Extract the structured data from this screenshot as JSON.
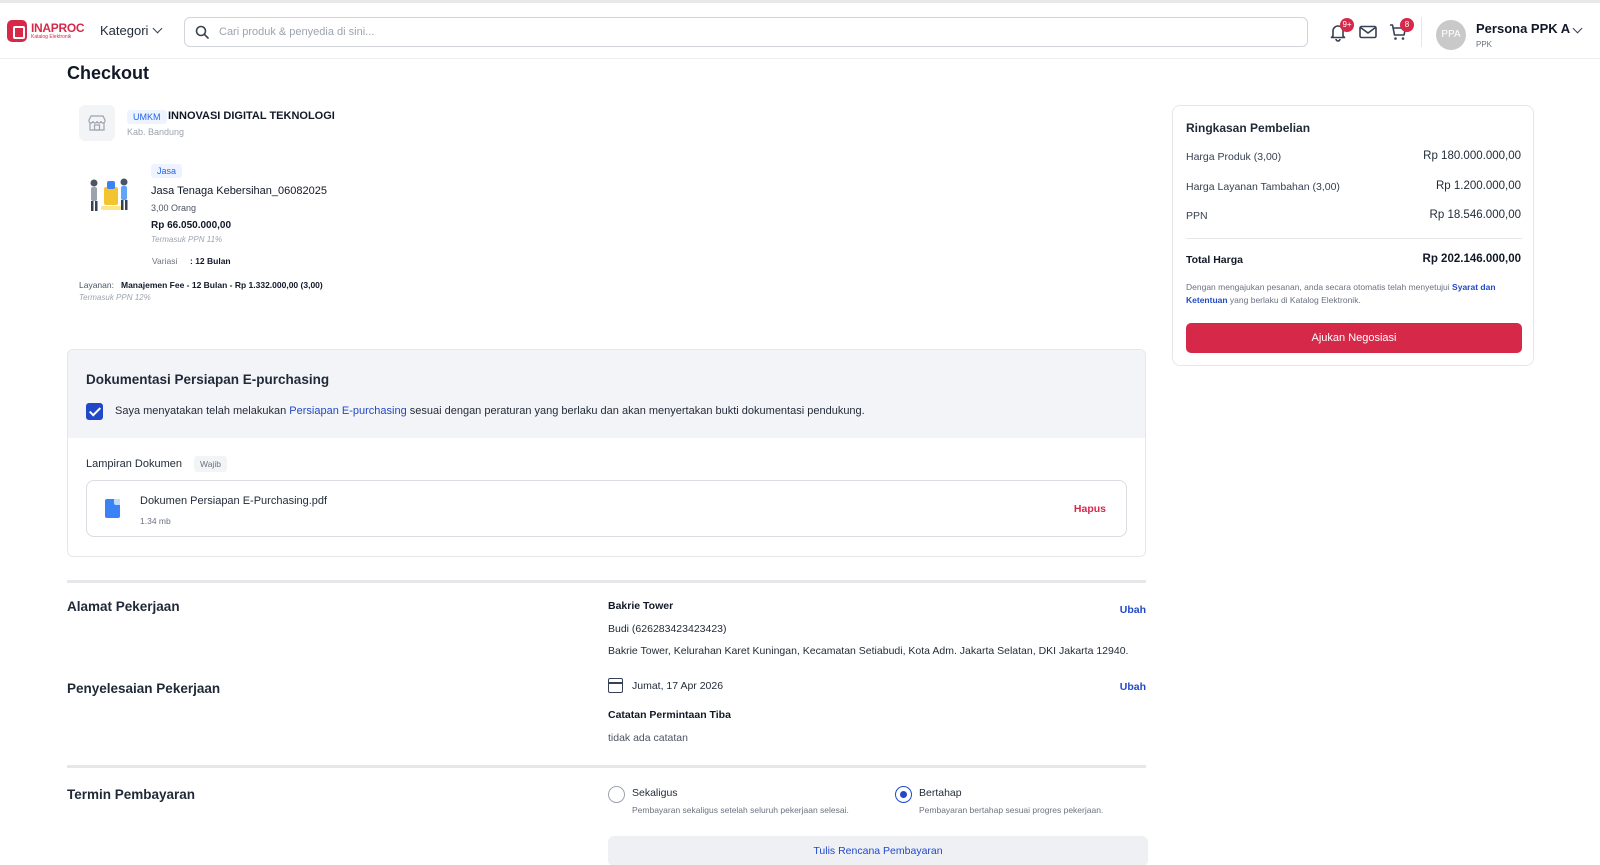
{
  "header": {
    "logo_title": "INAPROC",
    "logo_subtitle": "Katalog Elektronik",
    "kategori_label": "Kategori",
    "search_placeholder": "Cari produk & penyedia di sini...",
    "notif_badge": "9+",
    "cart_badge": "8",
    "avatar_initials": "PPA",
    "user_name": "Persona PPK A",
    "user_role": "PPK"
  },
  "page_title": "Checkout",
  "shop": {
    "tag": "UMKM",
    "name": "INNOVASI DIGITAL TEKNOLOGI",
    "location": "Kab. Bandung"
  },
  "product": {
    "tag": "Jasa",
    "name": "Jasa Tenaga Kebersihan_06082025",
    "qty": "3,00 Orang",
    "price": "Rp 66.050.000,00",
    "ppn_note": "Termasuk PPN 11%",
    "variant_label": "Variasi",
    "variant_value": ": 12 Bulan",
    "service_label": "Layanan:",
    "service_value": "Manajemen Fee - 12 Bulan - Rp 1.332.000,00 (3,00)",
    "service_ppn_note": "Termasuk PPN 12%"
  },
  "documentation": {
    "title": "Dokumentasi Persiapan E-purchasing",
    "statement_prefix": "Saya menyatakan telah melakukan ",
    "statement_link": "Persiapan E-purchasing",
    "statement_suffix": " sesuai dengan peraturan yang berlaku dan akan menyertakan bukti dokumentasi pendukung.",
    "attachment_label": "Lampiran Dokumen",
    "required_tag": "Wajib",
    "file_name": "Dokumen Persiapan E-Purchasing.pdf",
    "file_size": "1.34 mb",
    "delete_label": "Hapus"
  },
  "address": {
    "title": "Alamat Pekerjaan",
    "name": "Bakrie Tower",
    "contact": "Budi (626283423423423)",
    "full": "Bakrie Tower, Kelurahan Karet Kuningan, Kecamatan Setiabudi, Kota Adm. Jakarta Selatan, DKI Jakarta 12940.",
    "edit_label": "Ubah"
  },
  "completion": {
    "title": "Penyelesaian Pekerjaan",
    "date": "Jumat, 17 Apr 2026",
    "note_title": "Catatan Permintaan Tiba",
    "note_text": "tidak ada catatan",
    "edit_label": "Ubah"
  },
  "payment": {
    "title": "Termin Pembayaran",
    "options": [
      {
        "label": "Sekaligus",
        "desc": "Pembayaran sekaligus setelah seluruh pekerjaan selesai."
      },
      {
        "label": "Bertahap",
        "desc": "Pembayaran bertahap sesuai progres pekerjaan."
      }
    ],
    "selected": "Bertahap",
    "plan_button": "Tulis Rencana Pembayaran"
  },
  "summary": {
    "title": "Ringkasan Pembelian",
    "rows": [
      {
        "label": "Harga Produk (3,00)",
        "value": "Rp 180.000.000,00"
      },
      {
        "label": "Harga Layanan Tambahan (3,00)",
        "value": "Rp 1.200.000,00"
      },
      {
        "label": "PPN",
        "value": "Rp 18.546.000,00"
      }
    ],
    "total_label": "Total Harga",
    "total_value": "Rp 202.146.000,00",
    "note_prefix": "Dengan mengajukan pesanan, anda secara otomatis telah menyetujui ",
    "note_link": "Syarat dan Ketentuan",
    "note_suffix": " yang berlaku di Katalog Elektronik.",
    "submit_label": "Ajukan Negosiasi"
  },
  "colors": {
    "brand_red": "#d6294a",
    "link_blue": "#2149c7"
  }
}
